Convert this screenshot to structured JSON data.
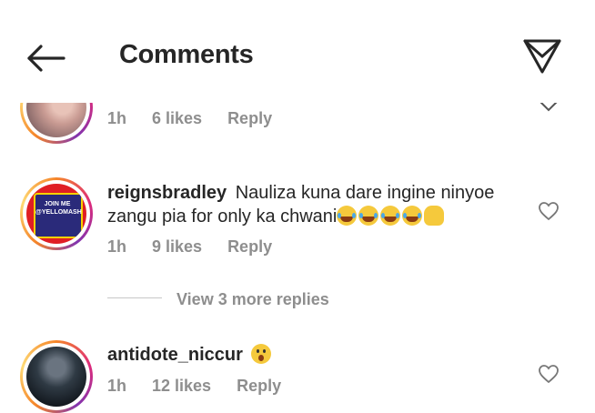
{
  "header": {
    "title": "Comments"
  },
  "comments": [
    {
      "time": "1h",
      "likes": "6 likes",
      "reply": "Reply"
    },
    {
      "username": "reignsbradley",
      "text_line1": "Nauliza kuna dare ingine ninyoe",
      "text_line2": "zangu pia for only ka chwani",
      "avatar_text": "JOIN ME @YELLOMASH",
      "time": "1h",
      "likes": "9 likes",
      "reply": "Reply",
      "view_replies": "View 3 more replies"
    },
    {
      "username": "antidote_niccur",
      "time": "1h",
      "likes": "12 likes",
      "reply": "Reply"
    }
  ],
  "icons": {
    "back": "arrow-left-icon",
    "send": "paper-plane-icon",
    "like": "heart-outline-icon",
    "expand": "chevron-down-icon"
  },
  "colors": {
    "text": "#262626",
    "muted": "#8e8e8e",
    "story_ring": "#dd2a7b"
  }
}
